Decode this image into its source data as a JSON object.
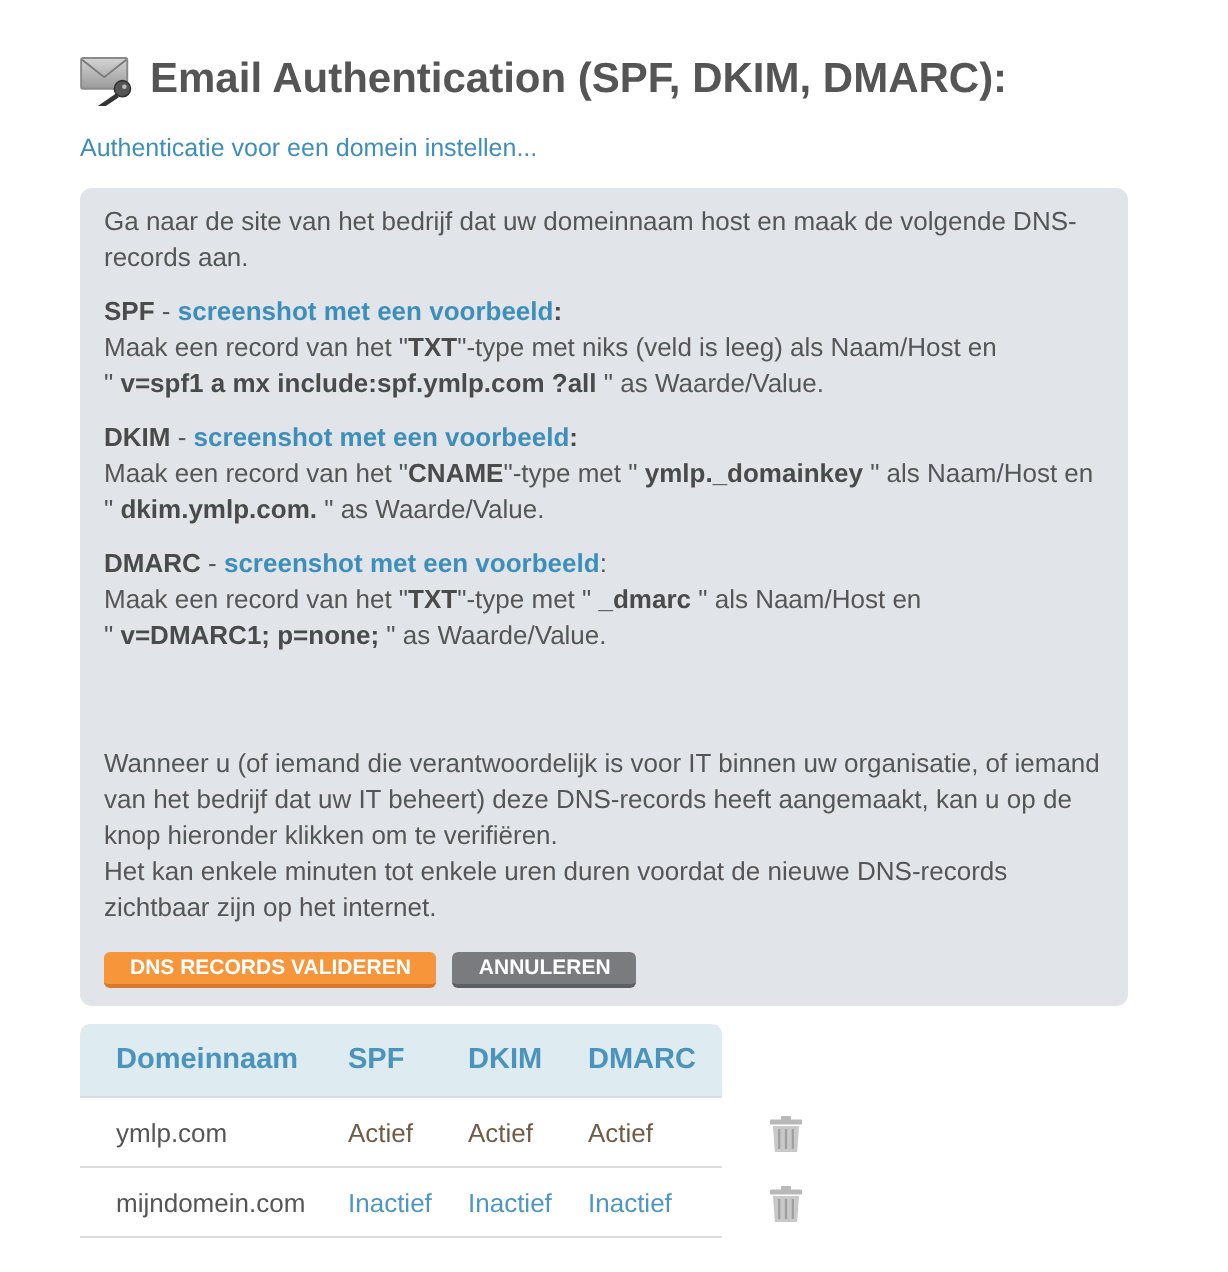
{
  "page": {
    "title": "Email Authentication (SPF, DKIM, DMARC):",
    "setup_link": "Authenticatie voor een domein instellen..."
  },
  "instructions": {
    "intro": "Ga naar de site van het bedrijf dat uw domeinnaam host en maak de volgende DNS-records aan.",
    "records": [
      {
        "heading": "**SPF** -",
        "link": "screenshot met een voorbeeld",
        "heading_end": "**:**",
        "lines": [
          "Maak een record van het \"**TXT**\"-type met niks (veld is leeg) als Naam/Host en",
          "\" **v=spf1 a mx include:spf.ymlp.com ?all** \" as Waarde/Value."
        ]
      },
      {
        "heading": "**DKIM** -",
        "link": "screenshot met een voorbeeld",
        "heading_end": "**:**",
        "lines": [
          "Maak een record van het \"**CNAME**\"-type met \" **ymlp._domainkey** \" als Naam/Host en",
          "\" **dkim.ymlp.com.** \" as Waarde/Value."
        ]
      },
      {
        "heading": "**DMARC** -",
        "link": "screenshot met een voorbeeld",
        "heading_end": ":",
        "lines": [
          "Maak een record van het \"**TXT**\"-type met \" **_dmarc** \" als Naam/Host en",
          "\" **v=DMARC1; p=none;** \" as Waarde/Value."
        ]
      }
    ],
    "closing": [
      "Wanneer u (of iemand die verantwoordelijk is voor IT binnen uw organisatie, of iemand van het bedrijf dat uw IT beheert) deze DNS-records heeft aangemaakt, kan u op de knop hieronder klikken om te verifiëren.",
      "Het kan enkele minuten tot enkele uren duren voordat de nieuwe DNS-records zichtbaar zijn op het internet."
    ],
    "buttons": [
      {
        "label": "DNS RECORDS VALIDEREN",
        "kind": "primary"
      },
      {
        "label": "ANNULEREN",
        "kind": "secondary"
      }
    ]
  },
  "domains": {
    "columns": [
      "Domeinnaam",
      "SPF",
      "DKIM",
      "DMARC"
    ],
    "rows": [
      {
        "domain": "ymlp.com",
        "statuses": [
          {
            "text": "Actief",
            "active": true
          },
          {
            "text": "Actief",
            "active": true
          },
          {
            "text": "Actief",
            "active": true
          }
        ]
      },
      {
        "domain": "mijndomein.com",
        "statuses": [
          {
            "text": "Inactief",
            "active": false
          },
          {
            "text": "Inactief",
            "active": false
          },
          {
            "text": "Inactief",
            "active": false
          }
        ]
      }
    ]
  }
}
